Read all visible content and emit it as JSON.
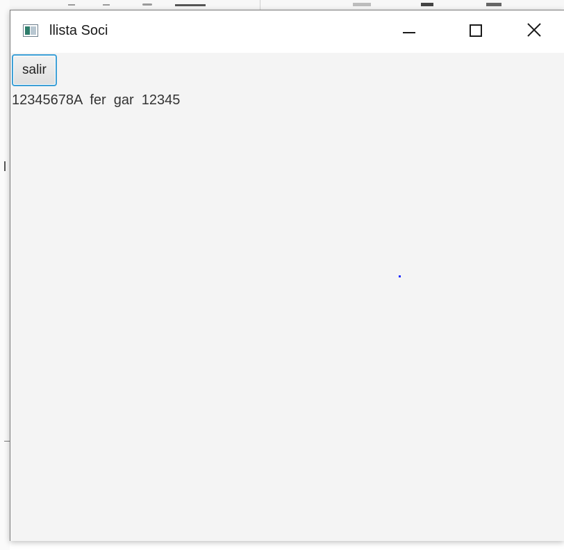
{
  "window": {
    "title": "llista Soci",
    "icon": "app-window-icon",
    "controls": [
      "minimize-icon",
      "maximize-icon",
      "close-icon"
    ]
  },
  "content": {
    "exit_button_label": "salir",
    "record_line": "12345678A  fer  gar  12345"
  },
  "colors": {
    "focus_border": "#3c9fd6",
    "content_background": "#f4f4f4",
    "title_bar": "#ffffff",
    "text": "#333333"
  }
}
